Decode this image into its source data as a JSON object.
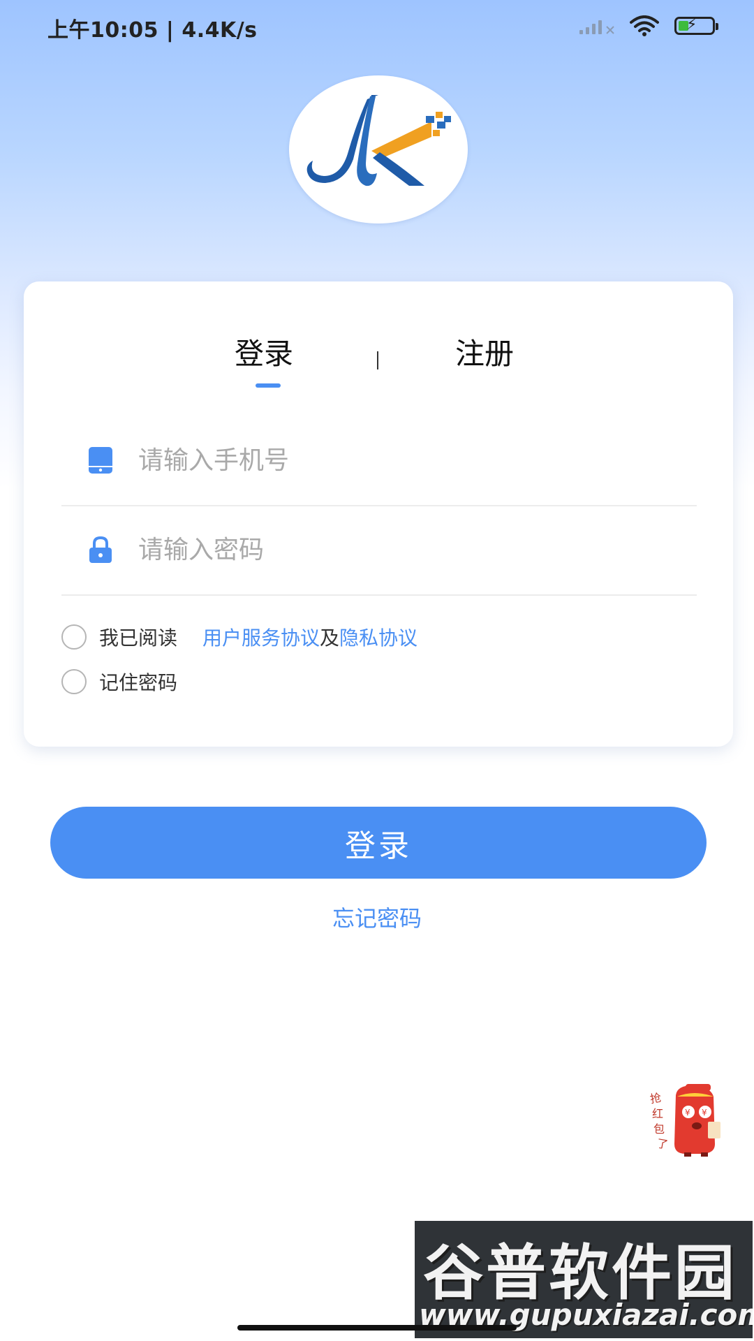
{
  "status_bar": {
    "time": "上午10:05 | 4.4K/s",
    "icons": [
      "signal-icon",
      "wifi-icon",
      "battery-charging-icon"
    ]
  },
  "logo": {
    "icon": "app-logo"
  },
  "tabs": [
    {
      "label": "登录",
      "active": true
    },
    {
      "label": "注册",
      "active": false
    }
  ],
  "form": {
    "phone_placeholder": "请输入手机号",
    "password_placeholder": "请输入密码",
    "phone_icon": "phone-icon",
    "password_icon": "lock-icon"
  },
  "agreement": {
    "prefix": "我已阅读",
    "link1": "用户服务协议",
    "conj": "及",
    "link2": "隐私协议",
    "checked": false
  },
  "remember": {
    "label": "记住密码",
    "checked": false
  },
  "login_button": "登录",
  "forgot_password": "忘记密码",
  "promo": {
    "label": "抢红包了",
    "icon": "red-envelope-mascot-icon"
  },
  "watermark": {
    "title": "谷普软件园",
    "url": "www.gupuxiazai.com"
  },
  "colors": {
    "accent": "#4a8ff3",
    "background_top": "#9ec4ff",
    "text": "#222222",
    "placeholder": "#a9a9a9"
  }
}
